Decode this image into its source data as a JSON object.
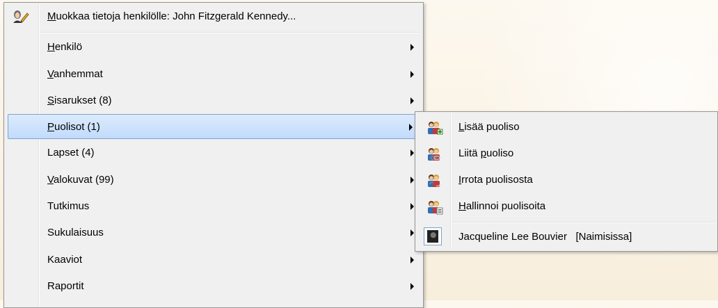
{
  "main_menu": {
    "edit_item": {
      "prefix": "",
      "underline": "M",
      "suffix": "uokkaa tietoja henkilölle: John Fitzgerald Kennedy...",
      "icon": "edit-person-icon"
    },
    "items": [
      {
        "underline": "H",
        "rest": "enkilö",
        "submenu": true
      },
      {
        "underline": "V",
        "rest": "anhemmat",
        "submenu": true
      },
      {
        "underline": "S",
        "rest": "isarukset (8)",
        "submenu": true
      },
      {
        "underline": "P",
        "rest": "uolisot (1)",
        "submenu": true,
        "selected": true
      },
      {
        "underline": "",
        "rest": "Lapset (4)",
        "submenu": true
      },
      {
        "underline": "V",
        "rest": "alokuvat (99)",
        "submenu": true
      },
      {
        "underline": "",
        "rest": "Tutkimus",
        "submenu": true
      },
      {
        "underline": "",
        "rest": "Sukulaisuus",
        "submenu": true
      },
      {
        "underline": "",
        "rest": "Kaaviot",
        "submenu": true
      },
      {
        "underline": "",
        "rest": "Raportit",
        "submenu": true
      }
    ]
  },
  "sub_menu": {
    "items": [
      {
        "prefix": "",
        "underline": "L",
        "suffix": "isää puoliso",
        "icon": "add-spouse-icon"
      },
      {
        "prefix": "Liitä ",
        "underline": "p",
        "suffix": "uoliso",
        "icon": "link-spouse-icon"
      },
      {
        "prefix": "",
        "underline": "I",
        "suffix": "rrota puolisosta",
        "icon": "unlink-spouse-icon"
      },
      {
        "prefix": "",
        "underline": "H",
        "suffix": "allinnoi puolisoita",
        "icon": "manage-spouses-icon"
      }
    ],
    "spouse": {
      "name": "Jacqueline Lee Bouvier",
      "status": "[Naimisissa]"
    }
  },
  "colors": {
    "highlight": "#c1dbfc",
    "highlight_border": "#7da2ce",
    "menu_bg": "#f0f0f0"
  }
}
